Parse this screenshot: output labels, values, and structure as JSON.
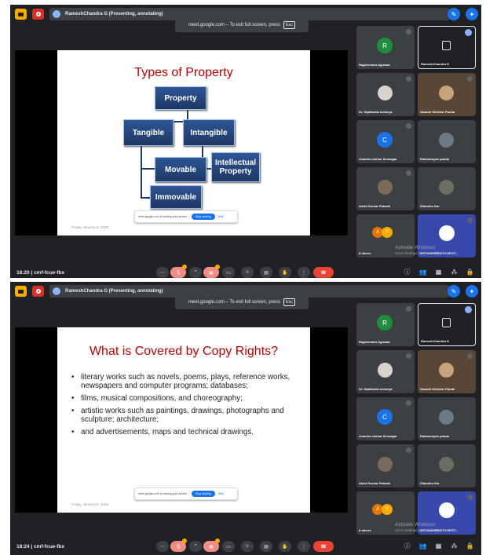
{
  "screens": [
    {
      "presenter_bar": "RameshChandra G (Presenting, annotating)",
      "fullscreen_notice": "meet.google.com – To exit full screen, press",
      "esc_key": "Esc",
      "slide_title": "Types of Property",
      "diagram": {
        "root": "Property",
        "tangible": "Tangible",
        "intangible": "Intangible",
        "movable": "Movable",
        "immovable": "Immovable",
        "intellectual": "Intellectual Property"
      },
      "slide_date": "Friday, January 9, 2026",
      "share_msg": "meet.google.com is sharing your screen.",
      "stop_sharing": "Stop sharing",
      "hide": "Hide",
      "time": "18:20",
      "meeting_code": "cmf-fcue-fbx"
    },
    {
      "presenter_bar": "RameshChandra G (Presenting, annotating)",
      "fullscreen_notice": "meet.google.com – To exit full screen, press",
      "esc_key": "Esc",
      "slide_title": "What is Covered by Copy Rights?",
      "bullets": [
        "literary works such as novels, poems, plays, reference works, newspapers and computer programs; databases;",
        "films, musical compositions, and choreography;",
        "artistic works such as paintings, drawings, photographs and sculpture; architecture;",
        " and advertisements, maps and technical drawings."
      ],
      "slide_date": "Friday, January 9, 2026",
      "share_msg": "meet.google.com is sharing your screen.",
      "stop_sharing": "Stop sharing",
      "hide": "Hide",
      "time": "18:24",
      "meeting_code": "cmf-fcue-fbx"
    }
  ],
  "participants": [
    {
      "name": "Raghvendra Agrawal",
      "initial": "R",
      "color": "#1e8e3e"
    },
    {
      "name": "RameshChandra G",
      "initial": "",
      "color": ""
    },
    {
      "name": "Dr. Diptikanta Acharya",
      "initial": "",
      "color": ""
    },
    {
      "name": "Sasank Shekhar Panda",
      "initial": "",
      "color": ""
    },
    {
      "name": "chandra sekhar bhosagar",
      "initial": "C",
      "color": "#1a73e8"
    },
    {
      "name": "Rabinarayan panda",
      "initial": "",
      "color": ""
    },
    {
      "name": "Asish Kumar Patnaik",
      "initial": "",
      "color": ""
    },
    {
      "name": "Sitanshu Kar",
      "initial": "",
      "color": ""
    },
    {
      "name": "8 others",
      "initial": "",
      "color": ""
    },
    {
      "name": "GIETUNIVERSITY SPOT...",
      "initial": "",
      "color": ""
    }
  ],
  "others_avatars": [
    "A",
    "Y"
  ],
  "watermark": {
    "title": "Activate Windows",
    "sub": "Go to Settings to activate Windows."
  }
}
